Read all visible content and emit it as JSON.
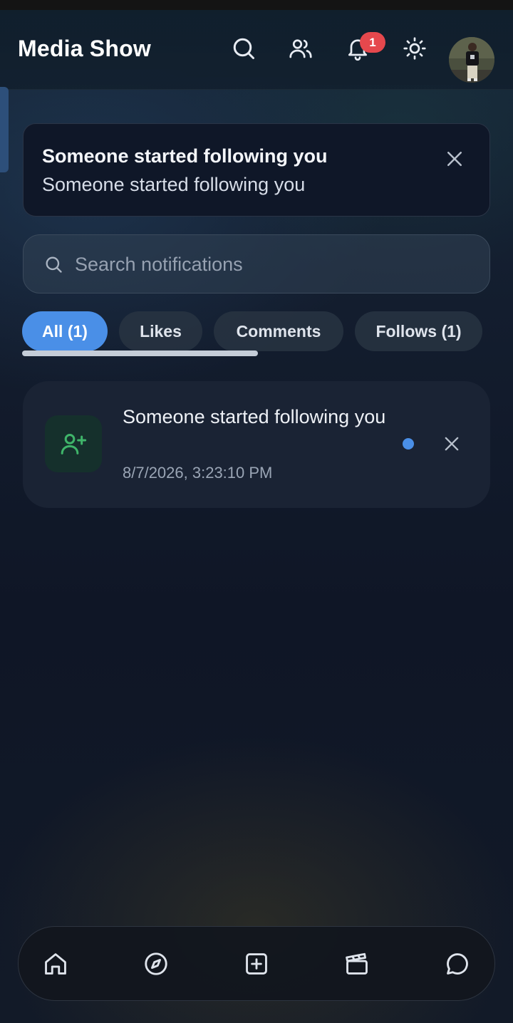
{
  "app": {
    "title": "Media Show"
  },
  "header": {
    "icons": [
      "search-icon",
      "friends-icon",
      "bell-icon",
      "sun-icon"
    ],
    "notification_badge": "1"
  },
  "toast": {
    "title": "Someone started following you",
    "message": "Someone started following you"
  },
  "search": {
    "placeholder": "Search notifications",
    "value": ""
  },
  "tabs": [
    {
      "label": "All (1)",
      "active": true
    },
    {
      "label": "Likes",
      "active": false
    },
    {
      "label": "Comments",
      "active": false
    },
    {
      "label": "Follows (1)",
      "active": false
    }
  ],
  "notifications": [
    {
      "text": "Someone started following you",
      "time": "8/7/2026, 3:23:10 PM",
      "icon": "user-plus-icon",
      "unread": true
    }
  ],
  "bottom_nav": {
    "items": [
      "home-icon",
      "explore-icon",
      "create-icon",
      "reels-icon",
      "messages-icon"
    ]
  },
  "colors": {
    "accent": "#4a8fe7",
    "badge": "#e5484d",
    "follow_icon": "#3fb56a"
  }
}
